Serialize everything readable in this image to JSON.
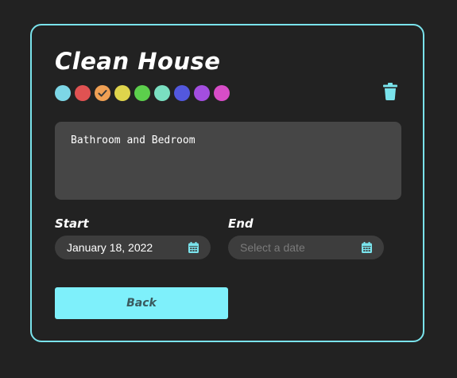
{
  "task": {
    "title": "Clean House",
    "notes": "Bathroom and Bedroom"
  },
  "colors": {
    "accent": "#7ae3ec",
    "button": "#7ef0fb",
    "background": "#222222",
    "swatches": [
      "#7dd6e6",
      "#e05252",
      "#f0a054",
      "#dfd44c",
      "#5ccf4c",
      "#7adfc1",
      "#5358de",
      "#a34ee0",
      "#d84dc8"
    ],
    "selected_swatch_index": 2
  },
  "fields": {
    "start": {
      "label": "Start",
      "value": "January 18, 2022",
      "icon": "calendar-icon"
    },
    "end": {
      "label": "End",
      "value": "",
      "placeholder": "Select a date",
      "icon": "calendar-icon"
    }
  },
  "actions": {
    "delete_icon": "trash-icon",
    "back_label": "Back"
  }
}
